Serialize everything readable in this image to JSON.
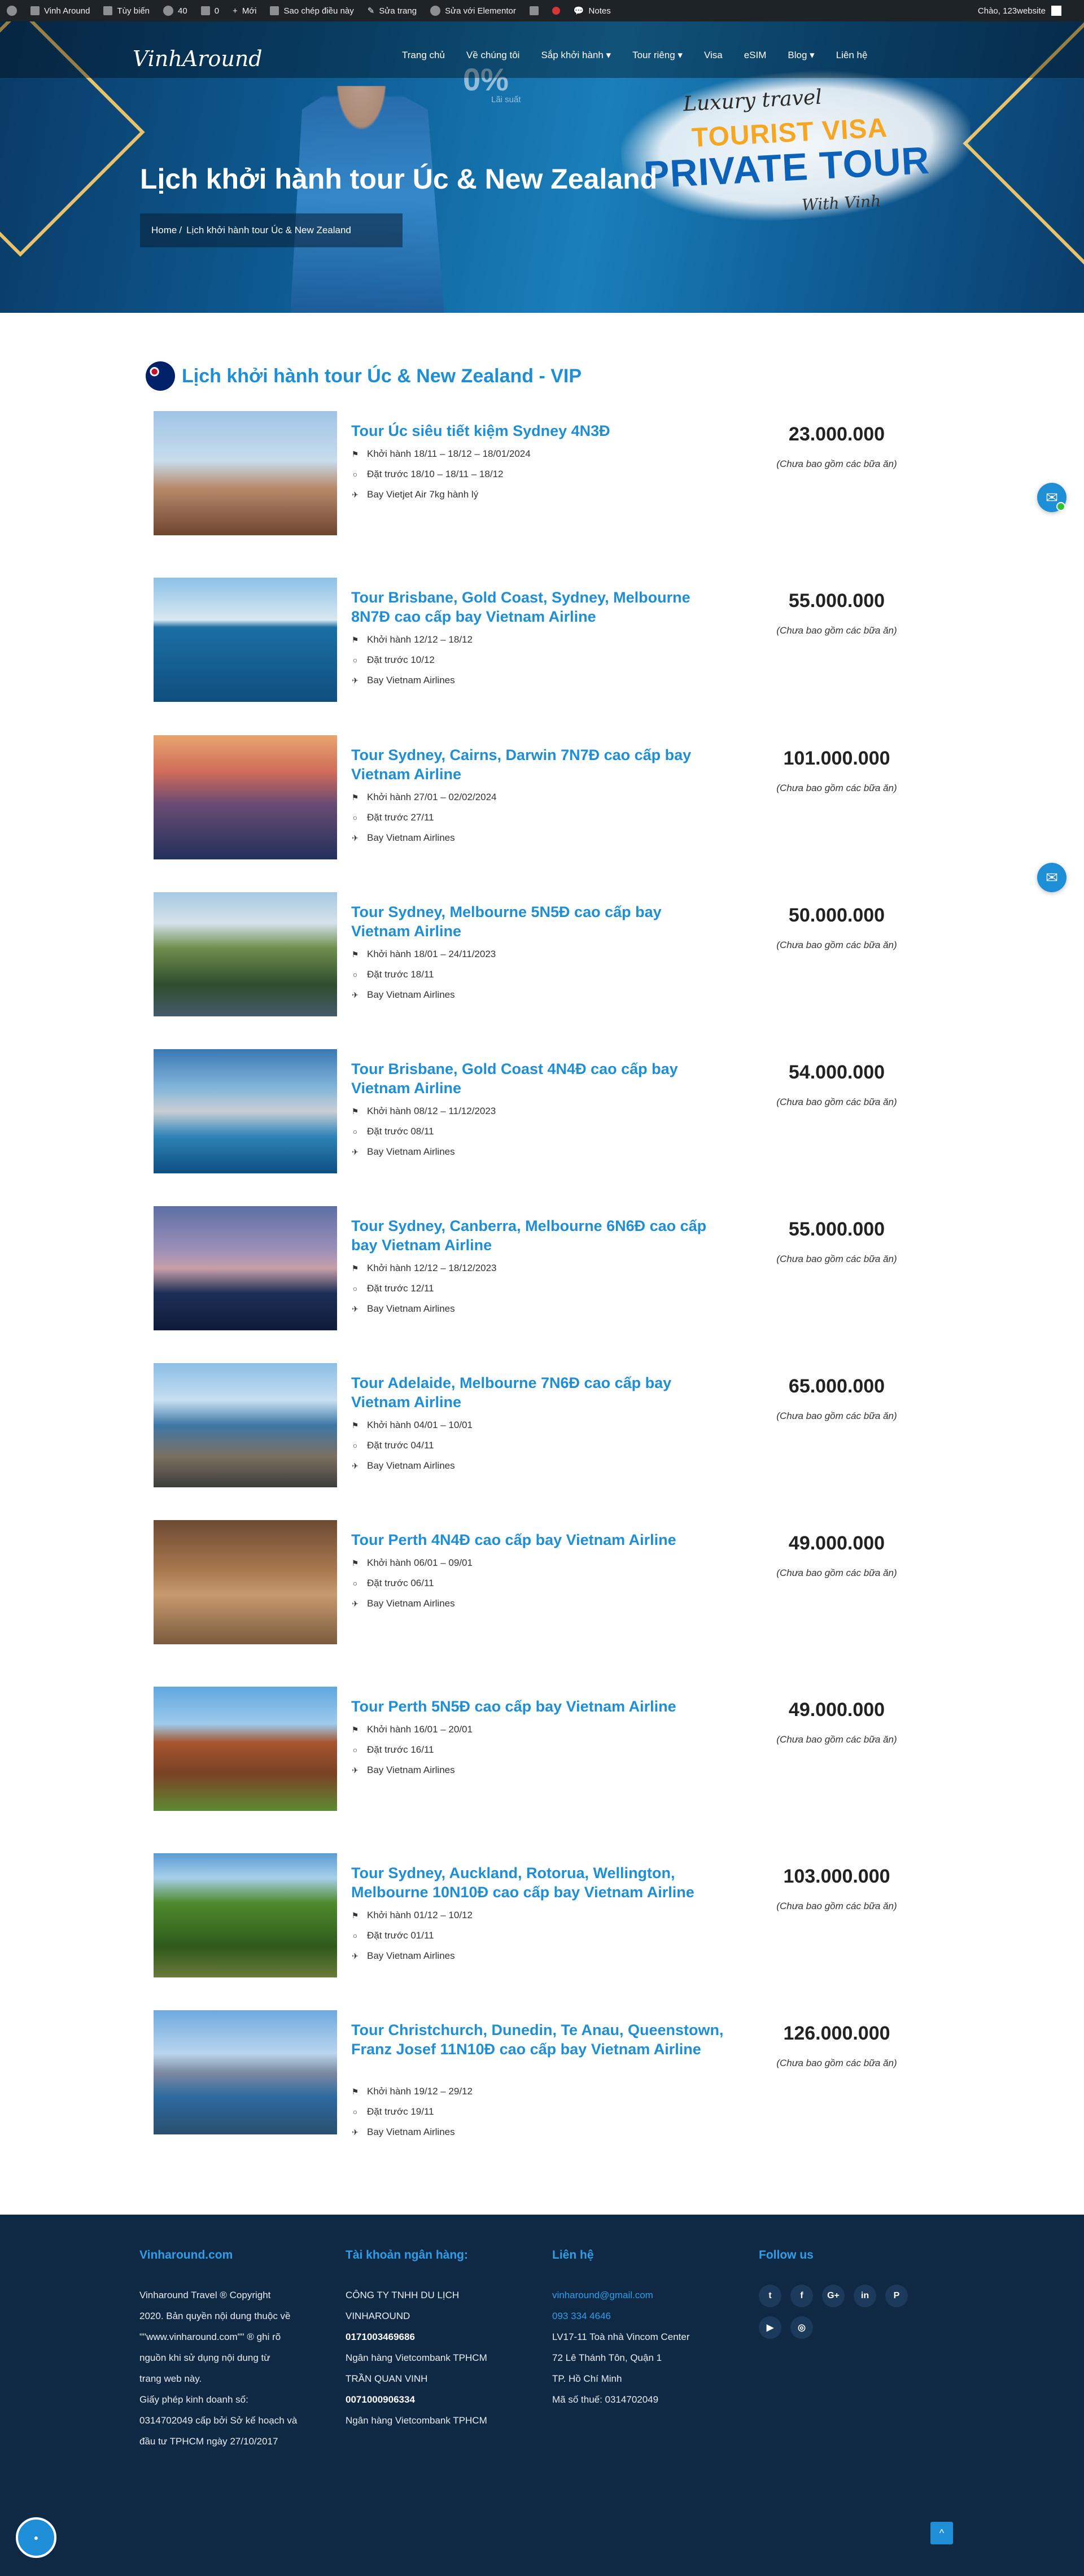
{
  "admin_bar": {
    "items": [
      "Vinh Around",
      "Tùy biến",
      "40",
      "0",
      "Mới",
      "Sao chép điều này",
      "Sửa trang",
      "Sửa với Elementor",
      "Notes"
    ],
    "greeting": "Chào, 123website"
  },
  "header": {
    "logo": "VinhAround",
    "menu": [
      "Trang chủ",
      "Về chúng tôi",
      "Sắp khởi hành ▾",
      "Tour riêng ▾",
      "Visa",
      "eSIM",
      "Blog ▾",
      "Liên hệ"
    ]
  },
  "hero": {
    "title": "Lịch khởi hành tour Úc & New Zealand",
    "breadcrumb_home": "Home",
    "breadcrumb_sep": "/",
    "breadcrumb_current": "Lịch khởi hành tour Úc & New Zealand",
    "banner_luxury": "Luxury travel",
    "banner_visa": "TOURIST VISA",
    "banner_private": "PRIVATE TOUR",
    "banner_with": "With Vinh",
    "banner_zero": "0%",
    "banner_lai_suat": "Lãi suất"
  },
  "section_title": "Lịch khởi hành tour Úc & New Zealand - VIP",
  "tours": [
    {
      "name": "Tour Úc siêu tiết kiệm Sydney 4N3Đ",
      "depart": "Khởi hành 18/11 – 18/12 – 18/01/2024",
      "book": "Đặt trước 18/10 – 18/11 – 18/12",
      "fly": "Bay Vietjet Air 7kg hành lý",
      "price": "23.000.000",
      "note": "(Chưa bao gồm các bữa ăn)"
    },
    {
      "name": "Tour Brisbane, Gold Coast, Sydney, Melbourne 8N7Đ cao cấp bay Vietnam Airline",
      "depart": "Khởi hành  12/12 – 18/12",
      "book": "Đặt trước  10/12",
      "fly": "Bay  Vietnam Airlines",
      "price": "55.000.000",
      "note": "(Chưa bao gồm các bữa ăn)"
    },
    {
      "name": "Tour Sydney, Cairns, Darwin 7N7Đ cao cấp bay Vietnam Airline",
      "depart": "Khởi hành 27/01 – 02/02/2024",
      "book": "Đặt trước  27/11",
      "fly": "Bay  Vietnam Airlines",
      "price": "101.000.000",
      "note": "(Chưa bao gồm các bữa ăn)"
    },
    {
      "name": "Tour Sydney, Melbourne 5N5Đ cao cấp bay Vietnam Airline",
      "depart": "Khởi hành 18/01 – 24/11/2023",
      "book": "Đặt trước  18/11",
      "fly": "Bay  Vietnam Airlines",
      "price": "50.000.000",
      "note": "(Chưa bao gồm các bữa ăn)"
    },
    {
      "name": "Tour Brisbane, Gold Coast 4N4Đ cao cấp bay Vietnam Airline",
      "depart": "Khởi hành 08/12 – 11/12/2023",
      "book": "Đặt trước 08/11",
      "fly": "Bay Vietnam Airlines",
      "price": "54.000.000",
      "note": "(Chưa bao gồm các bữa ăn)"
    },
    {
      "name": "Tour Sydney, Canberra, Melbourne 6N6Đ cao cấp bay Vietnam Airline",
      "depart": "Khởi hành 12/12 – 18/12/2023",
      "book": "Đặt trước 12/11",
      "fly": "Bay Vietnam Airlines",
      "price": "55.000.000",
      "note": "(Chưa bao gồm các bữa ăn)"
    },
    {
      "name": "Tour Adelaide, Melbourne 7N6Đ cao cấp bay Vietnam Airline",
      "depart": "Khởi hành 04/01 – 10/01",
      "book": "Đặt trước 04/11",
      "fly": "Bay Vietnam Airlines",
      "price": "65.000.000",
      "note": "(Chưa bao gồm các bữa ăn)"
    },
    {
      "name": "Tour Perth 4N4Đ cao cấp bay Vietnam Airline",
      "depart": "Khởi hành 06/01 – 09/01",
      "book": "Đặt trước 06/11",
      "fly": "Bay Vietnam Airlines",
      "price": "49.000.000",
      "note": "(Chưa bao gồm các bữa ăn)"
    },
    {
      "name": "Tour Perth 5N5Đ cao cấp bay Vietnam Airline",
      "depart": "Khởi hành 16/01 – 20/01",
      "book": "Đặt trước 16/11",
      "fly": "Bay Vietnam Airlines",
      "price": "49.000.000",
      "note": "(Chưa bao gồm các bữa ăn)"
    },
    {
      "name": "Tour Sydney, Auckland, Rotorua, Wellington, Melbourne 10N10Đ cao cấp bay Vietnam Airline",
      "depart": "Khởi hành 01/12 – 10/12",
      "book": "Đặt trước 01/11",
      "fly": "Bay Vietnam Airlines",
      "price": "103.000.000",
      "note": "(Chưa bao gồm các bữa ăn)"
    },
    {
      "name": "Tour Christchurch, Dunedin, Te Anau, Queenstown, Franz Josef 11N10Đ cao cấp bay Vietnam Airline",
      "depart": "Khởi hành 19/12 – 29/12",
      "book": "Đặt trước 19/11",
      "fly": "Bay Vietnam Airlines",
      "price": "126.000.000",
      "note": "(Chưa bao gồm các bữa ăn)"
    }
  ],
  "footer": {
    "col1_title": "Vinharound.com",
    "col1_lines": [
      "Vinharound Travel ® Copyright",
      "2020. Bản quyền nội dung thuộc về",
      "\"\"www.vinharound.com\"\" ® ghi rõ",
      "nguồn khi sử dụng nội dung từ",
      "trang web này.",
      "Giấy phép kinh doanh số:",
      "0314702049 cấp bởi Sở kế hoạch và",
      "đầu tư TPHCM ngày 27/10/2017"
    ],
    "col2_title": "Tài khoản ngân hàng:",
    "col2_company": "CÔNG TY TNHH DU LỊCH",
    "col2_company2": "VINHAROUND",
    "col2_acc1": "0171003469686",
    "col2_bank1": "Ngân hàng Vietcombank TPHCM",
    "col2_name2": "TRẦN QUAN VINH",
    "col2_acc2": "0071000906334",
    "col2_bank2": "Ngân hàng Vietcombank TPHCM",
    "col3_title": "Liên hệ",
    "col3_email": "vinharound@gmail.com",
    "col3_phone": "093 334 4646",
    "col3_addr1": "LV17-11 Toà nhà Vincom Center",
    "col3_addr2": "72 Lê Thánh Tôn, Quận 1",
    "col3_addr3": "TP. Hồ Chí Minh",
    "col3_tax": "Mã số thuế: 0314702049",
    "col4_title": "Follow us",
    "social_icons": [
      "twitter-icon",
      "facebook-icon",
      "google-plus-icon",
      "linkedin-icon",
      "pinterest-icon",
      "youtube-icon",
      "instagram-icon"
    ]
  },
  "colors": {
    "accent": "#1e8fd6",
    "footer_bg": "#0f2944",
    "adminbar": "#1d2327"
  }
}
